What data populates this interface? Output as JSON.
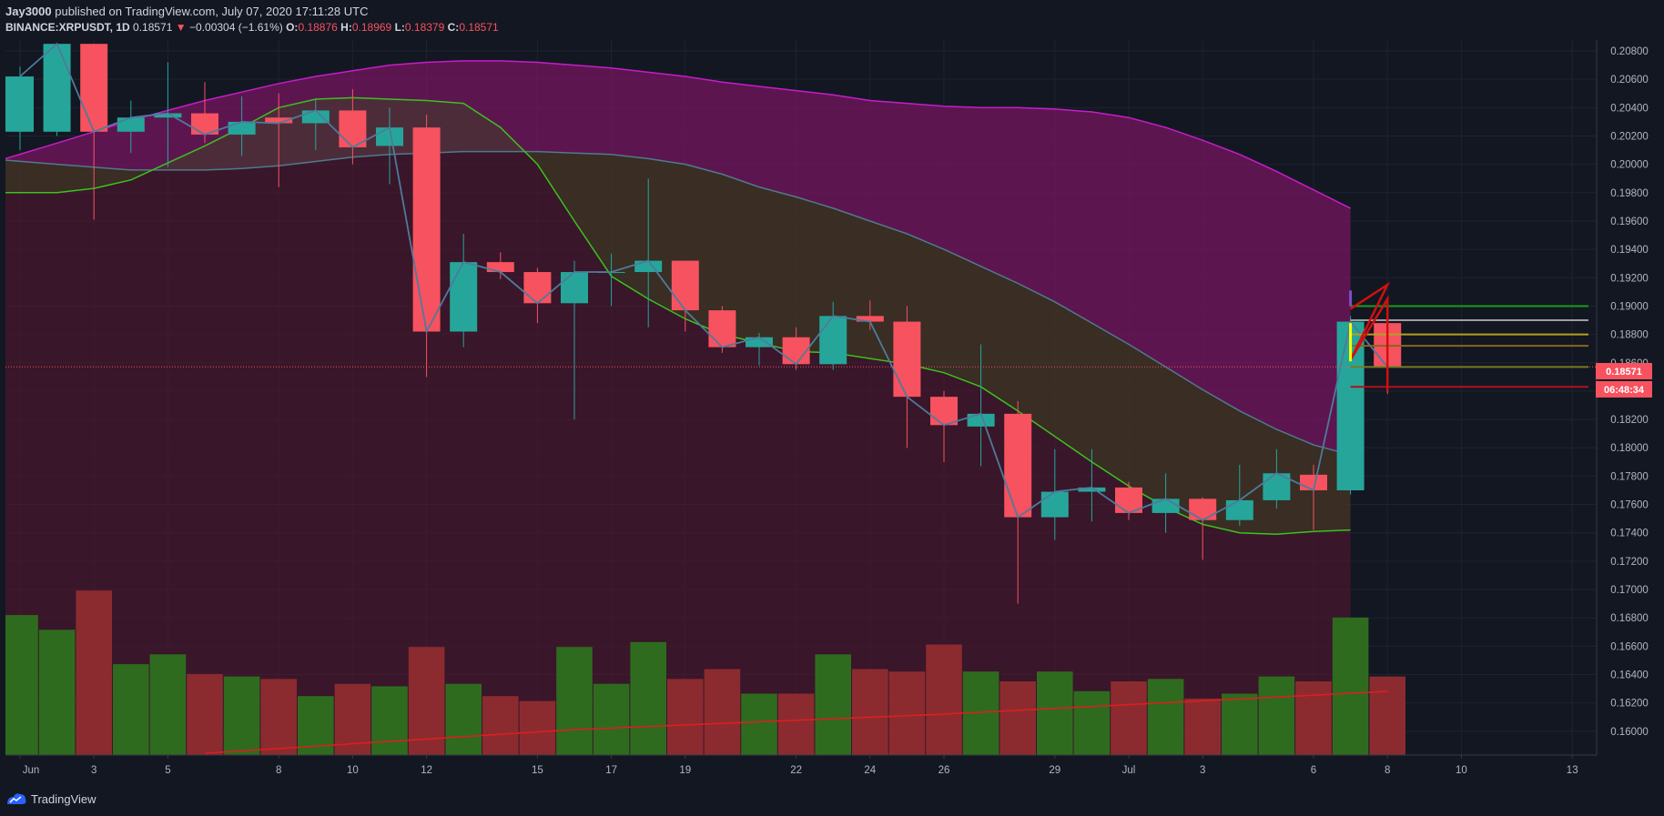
{
  "header": {
    "author": "Jay3000",
    "published": " published on TradingView.com, July 07, 2020 17:11:28 UTC",
    "symbol": "BINANCE:XRPUSDT, 1D",
    "last": "0.18571",
    "change": "−0.00304 (−1.61%)",
    "o_label": "O:",
    "o": "0.18876",
    "h_label": "H:",
    "h": "0.18969",
    "l_label": "L:",
    "l": "0.18379",
    "c_label": "C:",
    "c": "0.18571"
  },
  "footer": {
    "brand": "TradingView"
  },
  "price_tag": {
    "price": "0.18571",
    "countdown": "06:48:34"
  },
  "colors": {
    "up": "#26a69a",
    "down": "#f7525f",
    "vol_up": "#2f6b1f",
    "vol_down": "#8b2b2f",
    "bb_upper": "#c41ec8",
    "bb_mid": "#4f7a8c",
    "bb_lower": "#3cc11e",
    "close_line": "#4f7a9c",
    "vol_ma": "#e01e1e",
    "bg": "#131722"
  },
  "chart_data": {
    "type": "candlestick",
    "symbol": "BINANCE:XRPUSDT",
    "interval": "1D",
    "y_ticks": [
      "0.20800",
      "0.20600",
      "0.20400",
      "0.20200",
      "0.20000",
      "0.19800",
      "0.19600",
      "0.19400",
      "0.19200",
      "0.19000",
      "0.18800",
      "0.18600",
      "0.18400",
      "0.18200",
      "0.18000",
      "0.17800",
      "0.17600",
      "0.17400",
      "0.17200",
      "0.17000",
      "0.16800",
      "0.16600",
      "0.16400",
      "0.16200",
      "0.16000"
    ],
    "x_ticks": [
      {
        "day": 0,
        "label": "Jun"
      },
      {
        "day": 2,
        "label": "3"
      },
      {
        "day": 4,
        "label": "5"
      },
      {
        "day": 7,
        "label": "8"
      },
      {
        "day": 9,
        "label": "10"
      },
      {
        "day": 11,
        "label": "12"
      },
      {
        "day": 14,
        "label": "15"
      },
      {
        "day": 16,
        "label": "17"
      },
      {
        "day": 18,
        "label": "19"
      },
      {
        "day": 21,
        "label": "22"
      },
      {
        "day": 23,
        "label": "24"
      },
      {
        "day": 25,
        "label": "26"
      },
      {
        "day": 28,
        "label": "29"
      },
      {
        "day": 30,
        "label": "Jul"
      },
      {
        "day": 32,
        "label": "3"
      },
      {
        "day": 35,
        "label": "6"
      },
      {
        "day": 37,
        "label": "8"
      },
      {
        "day": 39,
        "label": "10"
      },
      {
        "day": 42,
        "label": "13"
      }
    ],
    "candles": [
      {
        "o": 0.2023,
        "h": 0.2069,
        "l": 0.201,
        "c": 0.2062
      },
      {
        "o": 0.2023,
        "h": 0.2085,
        "l": 0.202,
        "c": 0.2085
      },
      {
        "o": 0.2085,
        "h": 0.2085,
        "l": 0.1961,
        "c": 0.2023
      },
      {
        "o": 0.2023,
        "h": 0.2045,
        "l": 0.2008,
        "c": 0.2033
      },
      {
        "o": 0.2033,
        "h": 0.2072,
        "l": 0.1998,
        "c": 0.2036
      },
      {
        "o": 0.2036,
        "h": 0.2058,
        "l": 0.2015,
        "c": 0.2021
      },
      {
        "o": 0.2021,
        "h": 0.2048,
        "l": 0.2006,
        "c": 0.203
      },
      {
        "o": 0.2033,
        "h": 0.205,
        "l": 0.1984,
        "c": 0.2029
      },
      {
        "o": 0.2029,
        "h": 0.2046,
        "l": 0.201,
        "c": 0.2038
      },
      {
        "o": 0.2038,
        "h": 0.2053,
        "l": 0.2,
        "c": 0.2012
      },
      {
        "o": 0.2013,
        "h": 0.204,
        "l": 0.1986,
        "c": 0.2026
      },
      {
        "o": 0.2026,
        "h": 0.2035,
        "l": 0.185,
        "c": 0.1882
      },
      {
        "o": 0.1882,
        "h": 0.1951,
        "l": 0.1871,
        "c": 0.1931
      },
      {
        "o": 0.1931,
        "h": 0.1938,
        "l": 0.1919,
        "c": 0.1924
      },
      {
        "o": 0.1924,
        "h": 0.1927,
        "l": 0.1888,
        "c": 0.1902
      },
      {
        "o": 0.1902,
        "h": 0.1932,
        "l": 0.182,
        "c": 0.1924
      },
      {
        "o": 0.1924,
        "h": 0.1937,
        "l": 0.19,
        "c": 0.1924
      },
      {
        "o": 0.1924,
        "h": 0.199,
        "l": 0.1885,
        "c": 0.1932
      },
      {
        "o": 0.1932,
        "h": 0.1932,
        "l": 0.1882,
        "c": 0.1897
      },
      {
        "o": 0.1897,
        "h": 0.19,
        "l": 0.1867,
        "c": 0.1871
      },
      {
        "o": 0.1871,
        "h": 0.1881,
        "l": 0.1858,
        "c": 0.1878
      },
      {
        "o": 0.1878,
        "h": 0.1885,
        "l": 0.1855,
        "c": 0.1859
      },
      {
        "o": 0.1859,
        "h": 0.1903,
        "l": 0.1855,
        "c": 0.1893
      },
      {
        "o": 0.1893,
        "h": 0.1904,
        "l": 0.1883,
        "c": 0.1889
      },
      {
        "o": 0.1889,
        "h": 0.19,
        "l": 0.18,
        "c": 0.1836
      },
      {
        "o": 0.1836,
        "h": 0.184,
        "l": 0.179,
        "c": 0.1816
      },
      {
        "o": 0.1815,
        "h": 0.1873,
        "l": 0.1787,
        "c": 0.1824
      },
      {
        "o": 0.1824,
        "h": 0.1833,
        "l": 0.169,
        "c": 0.1751
      },
      {
        "o": 0.1751,
        "h": 0.1799,
        "l": 0.1735,
        "c": 0.1769
      },
      {
        "o": 0.1769,
        "h": 0.1799,
        "l": 0.1748,
        "c": 0.1772
      },
      {
        "o": 0.1772,
        "h": 0.1776,
        "l": 0.1749,
        "c": 0.1754
      },
      {
        "o": 0.1754,
        "h": 0.1782,
        "l": 0.174,
        "c": 0.1764
      },
      {
        "o": 0.1764,
        "h": 0.1765,
        "l": 0.1721,
        "c": 0.1749
      },
      {
        "o": 0.1749,
        "h": 0.1788,
        "l": 0.1745,
        "c": 0.1763
      },
      {
        "o": 0.1763,
        "h": 0.1799,
        "l": 0.1757,
        "c": 0.1782
      },
      {
        "o": 0.1781,
        "h": 0.1788,
        "l": 0.1742,
        "c": 0.177
      },
      {
        "o": 0.177,
        "h": 0.1893,
        "l": 0.1767,
        "c": 0.1889
      },
      {
        "o": 0.1888,
        "h": 0.1897,
        "l": 0.1838,
        "c": 0.1857
      }
    ],
    "volume": {
      "axis_max": 1,
      "values": [
        0.57,
        0.51,
        0.67,
        0.37,
        0.41,
        0.33,
        0.32,
        0.31,
        0.24,
        0.29,
        0.28,
        0.44,
        0.29,
        0.24,
        0.22,
        0.44,
        0.29,
        0.46,
        0.31,
        0.35,
        0.25,
        0.25,
        0.41,
        0.35,
        0.34,
        0.45,
        0.34,
        0.3,
        0.34,
        0.26,
        0.3,
        0.31,
        0.23,
        0.25,
        0.32,
        0.3,
        0.56,
        0.32
      ]
    },
    "bollinger": {
      "upper": [
        0.2004,
        0.2015,
        0.2023,
        0.2031,
        0.2038,
        0.2045,
        0.2051,
        0.2057,
        0.2062,
        0.2066,
        0.207,
        0.2072,
        0.2073,
        0.2073,
        0.2072,
        0.207,
        0.2068,
        0.2065,
        0.2062,
        0.2058,
        0.2055,
        0.2052,
        0.2049,
        0.2045,
        0.2043,
        0.2041,
        0.204,
        0.204,
        0.2039,
        0.2037,
        0.2033,
        0.2026,
        0.2017,
        0.2007,
        0.1995,
        0.1982,
        0.1969
      ],
      "middle": [
        0.2003,
        0.2,
        0.1998,
        0.1996,
        0.1996,
        0.1996,
        0.1997,
        0.1999,
        0.2002,
        0.2005,
        0.2007,
        0.2008,
        0.2009,
        0.2009,
        0.2009,
        0.2008,
        0.2007,
        0.2004,
        0.2,
        0.1993,
        0.1984,
        0.1977,
        0.1969,
        0.196,
        0.1951,
        0.194,
        0.1928,
        0.1916,
        0.1903,
        0.1888,
        0.1873,
        0.1857,
        0.1841,
        0.1826,
        0.1813,
        0.1802,
        0.1795
      ],
      "lower": [
        0.198,
        0.198,
        0.1983,
        0.1989,
        0.2001,
        0.2013,
        0.2026,
        0.204,
        0.2046,
        0.2047,
        0.2046,
        0.2045,
        0.2043,
        0.2026,
        0.2,
        0.196,
        0.1921,
        0.1905,
        0.1891,
        0.188,
        0.1874,
        0.1868,
        0.1867,
        0.1863,
        0.1859,
        0.1853,
        0.1843,
        0.1826,
        0.1808,
        0.179,
        0.1773,
        0.1758,
        0.1746,
        0.174,
        0.1739,
        0.1741,
        0.1742
      ]
    }
  }
}
